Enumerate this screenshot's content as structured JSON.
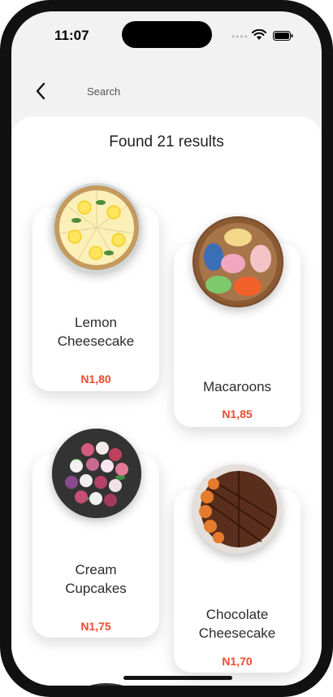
{
  "status_bar": {
    "time": "11:07"
  },
  "header": {
    "back_label": "back",
    "search_label": "Search"
  },
  "results": {
    "title": "Found 21 results"
  },
  "products": [
    {
      "name_line1": "Lemon",
      "name_line2": "Cheesecake",
      "price": "N1,80",
      "image": "lemon-cheesecake-image"
    },
    {
      "name_line1": "Macaroons",
      "name_line2": "",
      "price": "N1,85",
      "image": "macaroons-image"
    },
    {
      "name_line1": "Cream",
      "name_line2": "Cupcakes",
      "price": "N1,75",
      "image": "cream-cupcakes-image"
    },
    {
      "name_line1": "Chocolate",
      "name_line2": "Cheesecake",
      "price": "N1,70",
      "image": "chocolate-cheesecake-image"
    }
  ],
  "colors": {
    "price": "#ef4b2a",
    "card": "#ffffff",
    "background": "#f2f2f2"
  }
}
